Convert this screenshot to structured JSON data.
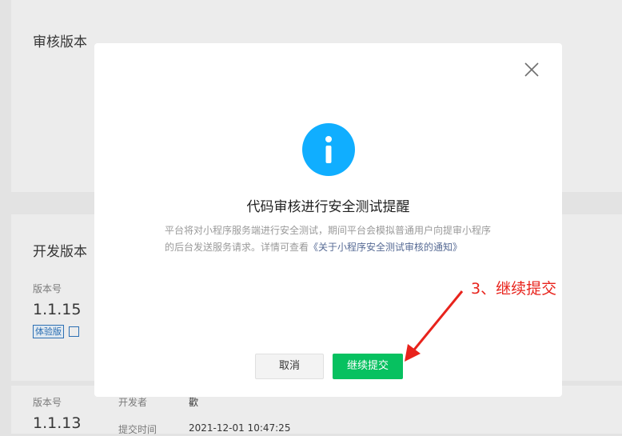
{
  "background": {
    "review_section_title": "审核版本",
    "dev_section_title": "开发版本",
    "dev_version": {
      "version_label": "版本号",
      "version_number": "1.1.15",
      "badge": "体验版"
    },
    "lower_row": {
      "version_label": "版本号",
      "version_number": "1.1.13",
      "developer_label": "开发者",
      "developer_value": "歡",
      "submit_time_label": "提交时间",
      "submit_time_value": "2021-12-01 10:47:25"
    }
  },
  "modal": {
    "icon": "info-icon",
    "title": "代码审核进行安全测试提醒",
    "description": "平台将对小程序服务端进行安全测试，期间平台会模拟普通用户向提审小程序的后台发送服务请求。详情可查看",
    "link_text": "《关于小程序安全测试审核的通知》",
    "cancel_label": "取消",
    "confirm_label": "继续提交"
  },
  "annotation": {
    "text": "3、继续提交",
    "color": "#e8231c"
  },
  "colors": {
    "accent_green": "#07c160",
    "info_blue": "#10aeff",
    "link_blue": "#576b95"
  }
}
